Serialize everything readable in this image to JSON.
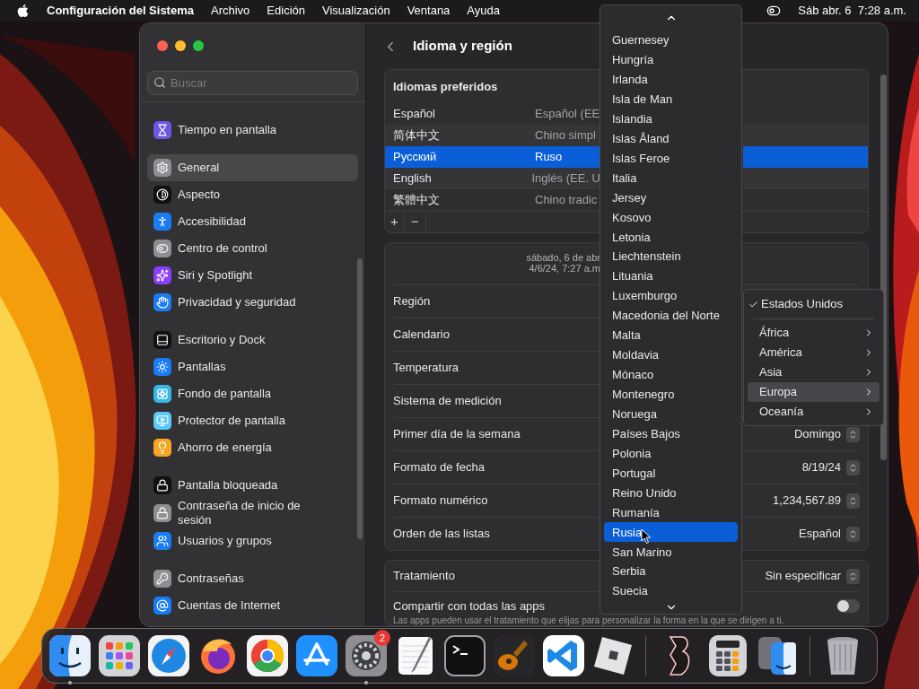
{
  "menu_bar": {
    "app": "Configuración del Sistema",
    "menus": [
      "Archivo",
      "Edición",
      "Visualización",
      "Ventana",
      "Ayuda"
    ],
    "clock": "Sáb abr. 6  7:28 a.m."
  },
  "sidebar": {
    "search": {
      "placeholder": "Buscar"
    },
    "groups": [
      [
        {
          "label": "Tiempo en pantalla",
          "kind": "hourglass",
          "color": "#6e57e0",
          "selected": false
        }
      ],
      [
        {
          "label": "General",
          "kind": "gear",
          "color": "#8e8e93",
          "selected": true
        },
        {
          "label": "Aspecto",
          "kind": "contrast",
          "color": "#111111",
          "selected": false
        },
        {
          "label": "Accesibilidad",
          "kind": "person",
          "color": "#1a7cf5",
          "selected": false
        },
        {
          "label": "Centro de control",
          "kind": "toggles",
          "color": "#8e8e93",
          "selected": false
        },
        {
          "label": "Siri y Spotlight",
          "kind": "sparkles",
          "color": "#8a3ffc",
          "selected": false
        },
        {
          "label": "Privacidad y seguridad",
          "kind": "hand",
          "color": "#1a7cf5",
          "selected": false
        }
      ],
      [
        {
          "label": "Escritorio y Dock",
          "kind": "dock",
          "color": "#111111",
          "selected": false
        },
        {
          "label": "Pantallas",
          "kind": "sun",
          "color": "#1a7cf5",
          "selected": false
        },
        {
          "label": "Fondo de pantalla",
          "kind": "flower",
          "color": "#38b6e8",
          "selected": false
        },
        {
          "label": "Protector de pantalla",
          "kind": "monitor",
          "color": "#5ac8fa",
          "selected": false
        },
        {
          "label": "Ahorro de energía",
          "kind": "bulb",
          "color": "#f5a623",
          "selected": false
        }
      ],
      [
        {
          "label": "Pantalla bloqueada",
          "kind": "lock",
          "color": "#111111",
          "selected": false
        },
        {
          "label": "Contraseña de inicio de sesión",
          "kind": "lock",
          "color": "#8e8e93",
          "selected": false
        },
        {
          "label": "Usuarios y grupos",
          "kind": "users",
          "color": "#1a7cf5",
          "selected": false
        }
      ],
      [
        {
          "label": "Contraseñas",
          "kind": "key",
          "color": "#8e8e93",
          "selected": false
        },
        {
          "label": "Cuentas de Internet",
          "kind": "at",
          "color": "#1a7cf5",
          "selected": false
        }
      ]
    ]
  },
  "content": {
    "title": "Idioma y región",
    "languages": {
      "title": "Idiomas preferidos",
      "rows": [
        {
          "name": "Español",
          "desc": "Español (EE",
          "selected": false
        },
        {
          "name": "简体中文",
          "desc": "Chino simpl",
          "selected": false
        },
        {
          "name": "Русский",
          "desc": "Ruso",
          "selected": true
        },
        {
          "name": "English",
          "desc": "Inglés (EE. U",
          "selected": false
        },
        {
          "name": "繁體中文",
          "desc": "Chino tradic",
          "selected": false
        }
      ],
      "add": "+",
      "remove": "−"
    },
    "region": {
      "date_lines": [
        "sábado, 6 de abr",
        "4/6/24, 7:27 a.m"
      ],
      "rows": [
        {
          "label": "Región"
        },
        {
          "label": "Calendario"
        },
        {
          "label": "Temperatura"
        },
        {
          "label": "Sistema de medición"
        },
        {
          "label": "Primer día de la semana",
          "value": "Domingo"
        },
        {
          "label": "Formato de fecha",
          "value": "8/19/24"
        },
        {
          "label": "Formato numérico",
          "value": "1,234,567.89"
        },
        {
          "label": "Orden de las listas",
          "value": "Español"
        }
      ]
    },
    "address": {
      "label": "Tratamiento",
      "value": "Sin especificar",
      "share_label": "Compartir con todas las apps",
      "share_on": false,
      "caption": "Las apps pueden usar el tratamiento que elijas para personalizar la forma en la que se dirigen a ti."
    }
  },
  "country_menu": {
    "items": [
      {
        "label": "Guernesey",
        "selected": false
      },
      {
        "label": "Hungría",
        "selected": false
      },
      {
        "label": "Irlanda",
        "selected": false
      },
      {
        "label": "Isla de Man",
        "selected": false
      },
      {
        "label": "Islandia",
        "selected": false
      },
      {
        "label": "Islas Åland",
        "selected": false
      },
      {
        "label": "Islas Feroe",
        "selected": false
      },
      {
        "label": "Italia",
        "selected": false
      },
      {
        "label": "Jersey",
        "selected": false
      },
      {
        "label": "Kosovo",
        "selected": false
      },
      {
        "label": "Letonia",
        "selected": false
      },
      {
        "label": "Liechtenstein",
        "selected": false
      },
      {
        "label": "Lituania",
        "selected": false
      },
      {
        "label": "Luxemburgo",
        "selected": false
      },
      {
        "label": "Macedonia del Norte",
        "selected": false
      },
      {
        "label": "Malta",
        "selected": false
      },
      {
        "label": "Moldavia",
        "selected": false
      },
      {
        "label": "Mónaco",
        "selected": false
      },
      {
        "label": "Montenegro",
        "selected": false
      },
      {
        "label": "Noruega",
        "selected": false
      },
      {
        "label": "Países Bajos",
        "selected": false
      },
      {
        "label": "Polonia",
        "selected": false
      },
      {
        "label": "Portugal",
        "selected": false
      },
      {
        "label": "Reino Unido",
        "selected": false
      },
      {
        "label": "Rumanía",
        "selected": false
      },
      {
        "label": "Rusia",
        "selected": true
      },
      {
        "label": "San Marino",
        "selected": false
      },
      {
        "label": "Serbia",
        "selected": false
      },
      {
        "label": "Suecia",
        "selected": false
      }
    ]
  },
  "region_menu": {
    "current": {
      "label": "Estados Unidos",
      "checked": true
    },
    "items": [
      {
        "label": "África",
        "selected": false
      },
      {
        "label": "América",
        "selected": false
      },
      {
        "label": "Asia",
        "selected": false
      },
      {
        "label": "Europa",
        "selected": true
      },
      {
        "label": "Oceanía",
        "selected": false
      }
    ]
  },
  "dock": {
    "items": [
      {
        "kind": "finder",
        "running": true
      },
      {
        "kind": "launchpad",
        "running": false
      },
      {
        "kind": "safari",
        "running": false
      },
      {
        "kind": "firefox",
        "running": false
      },
      {
        "kind": "chrome",
        "running": false
      },
      {
        "kind": "appstore",
        "running": false
      },
      {
        "kind": "settings",
        "running": true,
        "badge": "2"
      },
      {
        "kind": "textedit",
        "running": false
      },
      {
        "kind": "terminal",
        "running": false
      },
      {
        "kind": "garageband",
        "running": false
      },
      {
        "kind": "vscode",
        "running": false
      },
      {
        "kind": "roblox",
        "running": false
      },
      {
        "kind": "separator"
      },
      {
        "kind": "ribbon",
        "running": false
      },
      {
        "kind": "calculator",
        "running": false
      },
      {
        "kind": "migration",
        "running": false
      },
      {
        "kind": "separator"
      },
      {
        "kind": "trash",
        "running": false
      }
    ]
  }
}
